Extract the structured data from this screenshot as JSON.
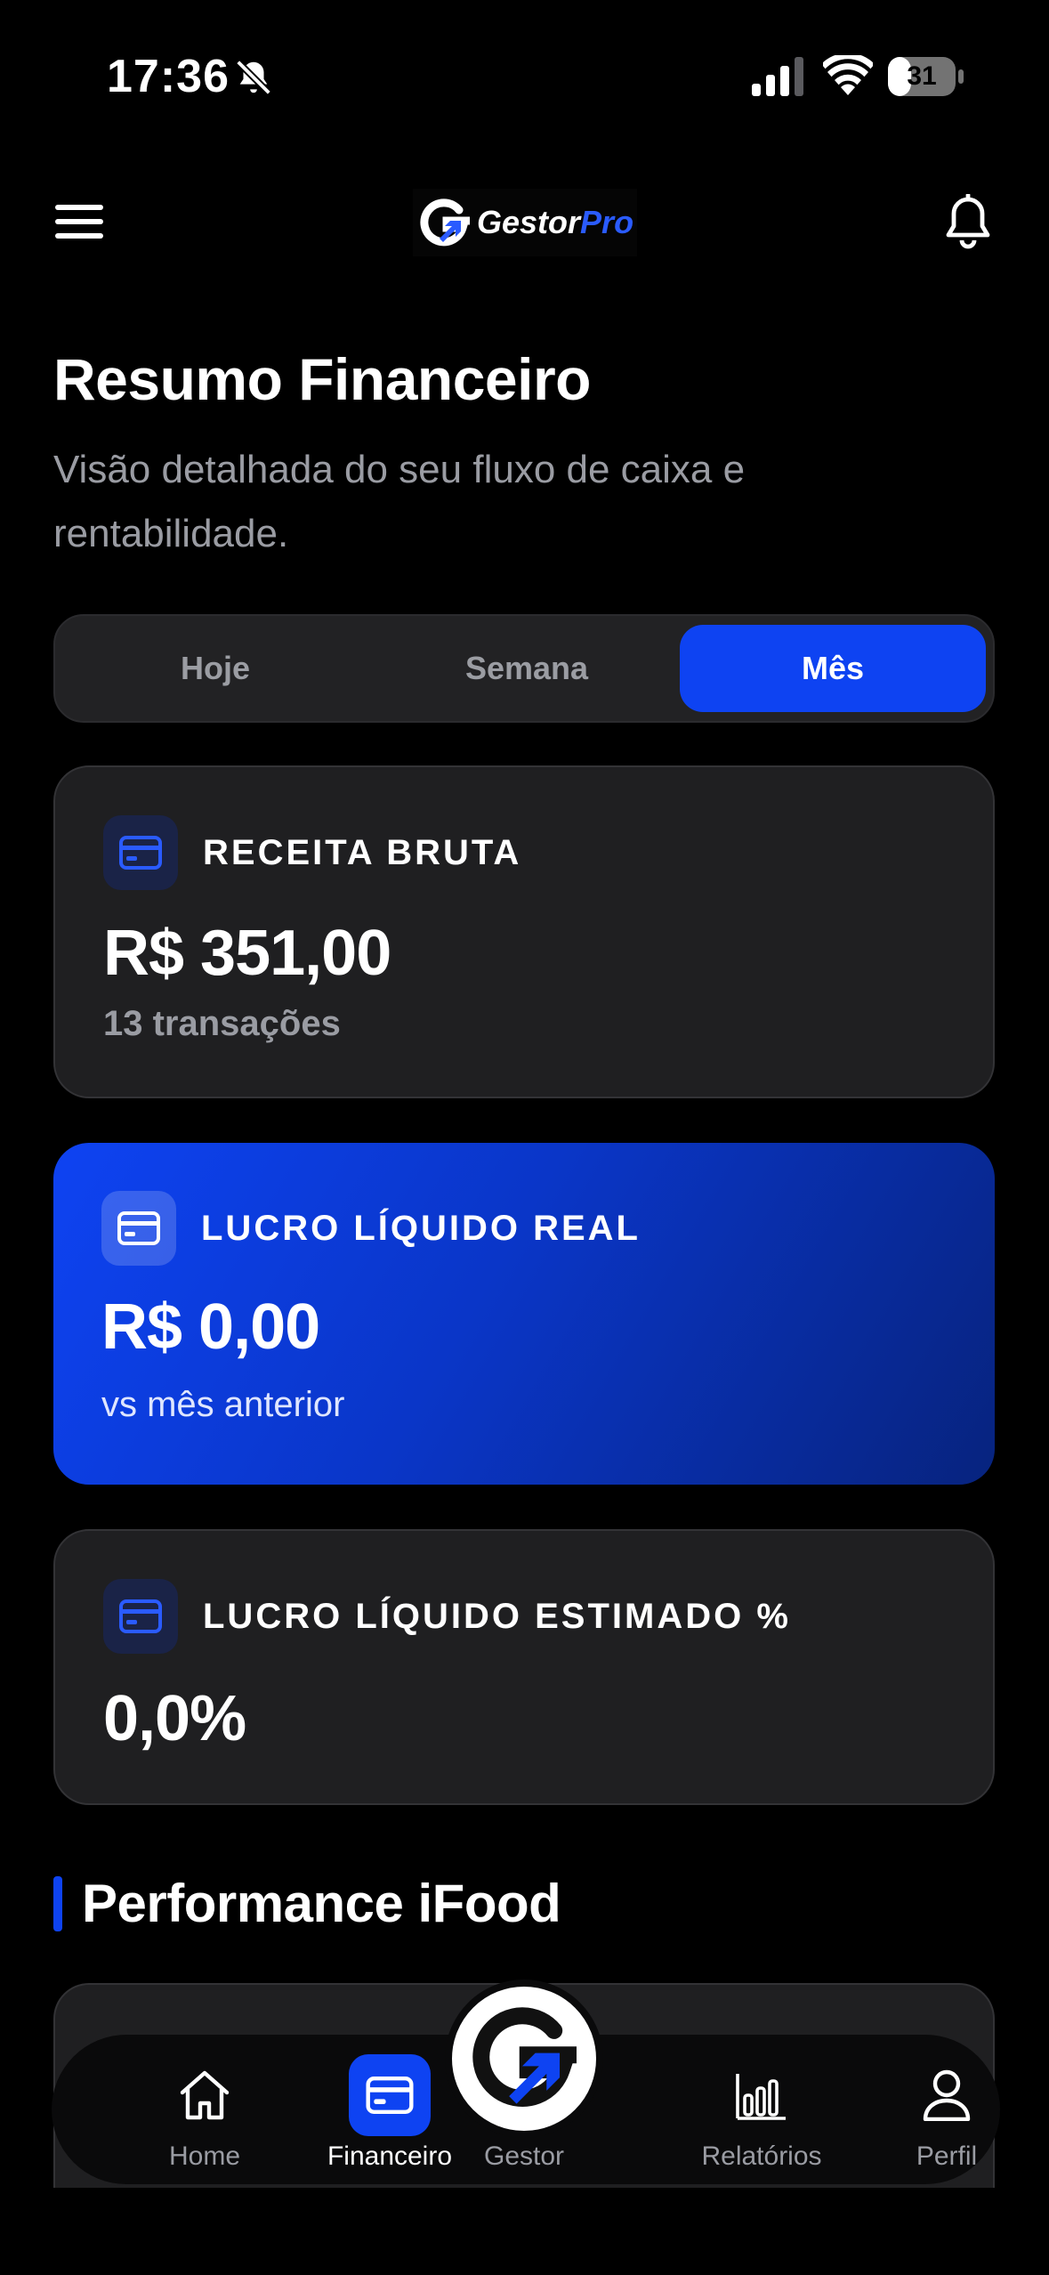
{
  "status_bar": {
    "time": "17:36",
    "battery": "31",
    "icons": [
      "bell-slash-icon",
      "cellular-signal-icon",
      "wifi-icon",
      "battery-icon"
    ]
  },
  "header": {
    "logo_text_main": "Gestor",
    "logo_text_accent": "Pro",
    "icons": [
      "hamburger-menu-icon",
      "notification-bell-icon"
    ]
  },
  "page": {
    "title": "Resumo Financeiro",
    "subtitle": "Visão detalhada do seu fluxo de caixa e rentabilidade."
  },
  "period_tabs": {
    "options": [
      "Hoje",
      "Semana",
      "Mês"
    ],
    "selected": "Mês"
  },
  "cards": [
    {
      "label": "RECEITA BRUTA",
      "value": "R$ 351,00",
      "sub": "13 transações",
      "icon": "credit-card-icon"
    },
    {
      "label": "LUCRO LÍQUIDO REAL",
      "value": "R$ 0,00",
      "sub": "vs mês anterior",
      "icon": "credit-card-icon"
    },
    {
      "label": "LUCRO LÍQUIDO ESTIMADO %",
      "value": "0,0%",
      "icon": "credit-card-icon"
    }
  ],
  "section": {
    "title": "Performance iFood"
  },
  "bottom_nav": {
    "items": [
      {
        "label": "Home",
        "icon": "home-icon"
      },
      {
        "label": "Financeiro",
        "icon": "credit-card-icon",
        "active": true
      },
      {
        "label": "Gestor",
        "icon": "gestor-logo-icon"
      },
      {
        "label": "Relatórios",
        "icon": "bar-chart-icon"
      },
      {
        "label": "Perfil",
        "icon": "user-icon"
      }
    ]
  },
  "colors": {
    "accent": "#0e43f2",
    "background": "#000000",
    "card": "#1f1f21",
    "muted_text": "#9a9ca3"
  }
}
